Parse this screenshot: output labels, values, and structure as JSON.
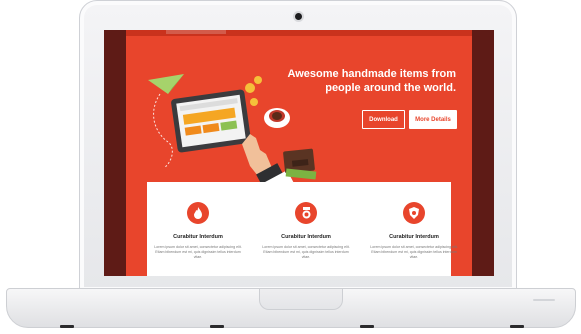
{
  "hero": {
    "headline_line1": "Awesome handmade items from",
    "headline_line2": "people around the world.",
    "download_label": "Download",
    "details_label": "More Details"
  },
  "features": [
    {
      "icon": "fire-icon",
      "title": "Curabitur Interdum",
      "description": "Lorem ipsum dolor sit amet, consectetur adipiscing elit. Etiam bibendum est mi, quis dignissim tellus interdum vitae."
    },
    {
      "icon": "badge-icon",
      "title": "Curabitur Interdum",
      "description": "Lorem ipsum dolor sit amet, consectetur adipiscing elit. Etiam bibendum est mi, quis dignissim tellus interdum vitae."
    },
    {
      "icon": "shield-icon",
      "title": "Curabitur Interdum",
      "description": "Lorem ipsum dolor sit amet, consectetur adipiscing elit. Etiam bibendum est mi, quis dignissim tellus interdum vitae."
    }
  ],
  "colors": {
    "accent": "#e8452c",
    "dark_side": "#5e1b16",
    "panel": "#ffffff"
  }
}
